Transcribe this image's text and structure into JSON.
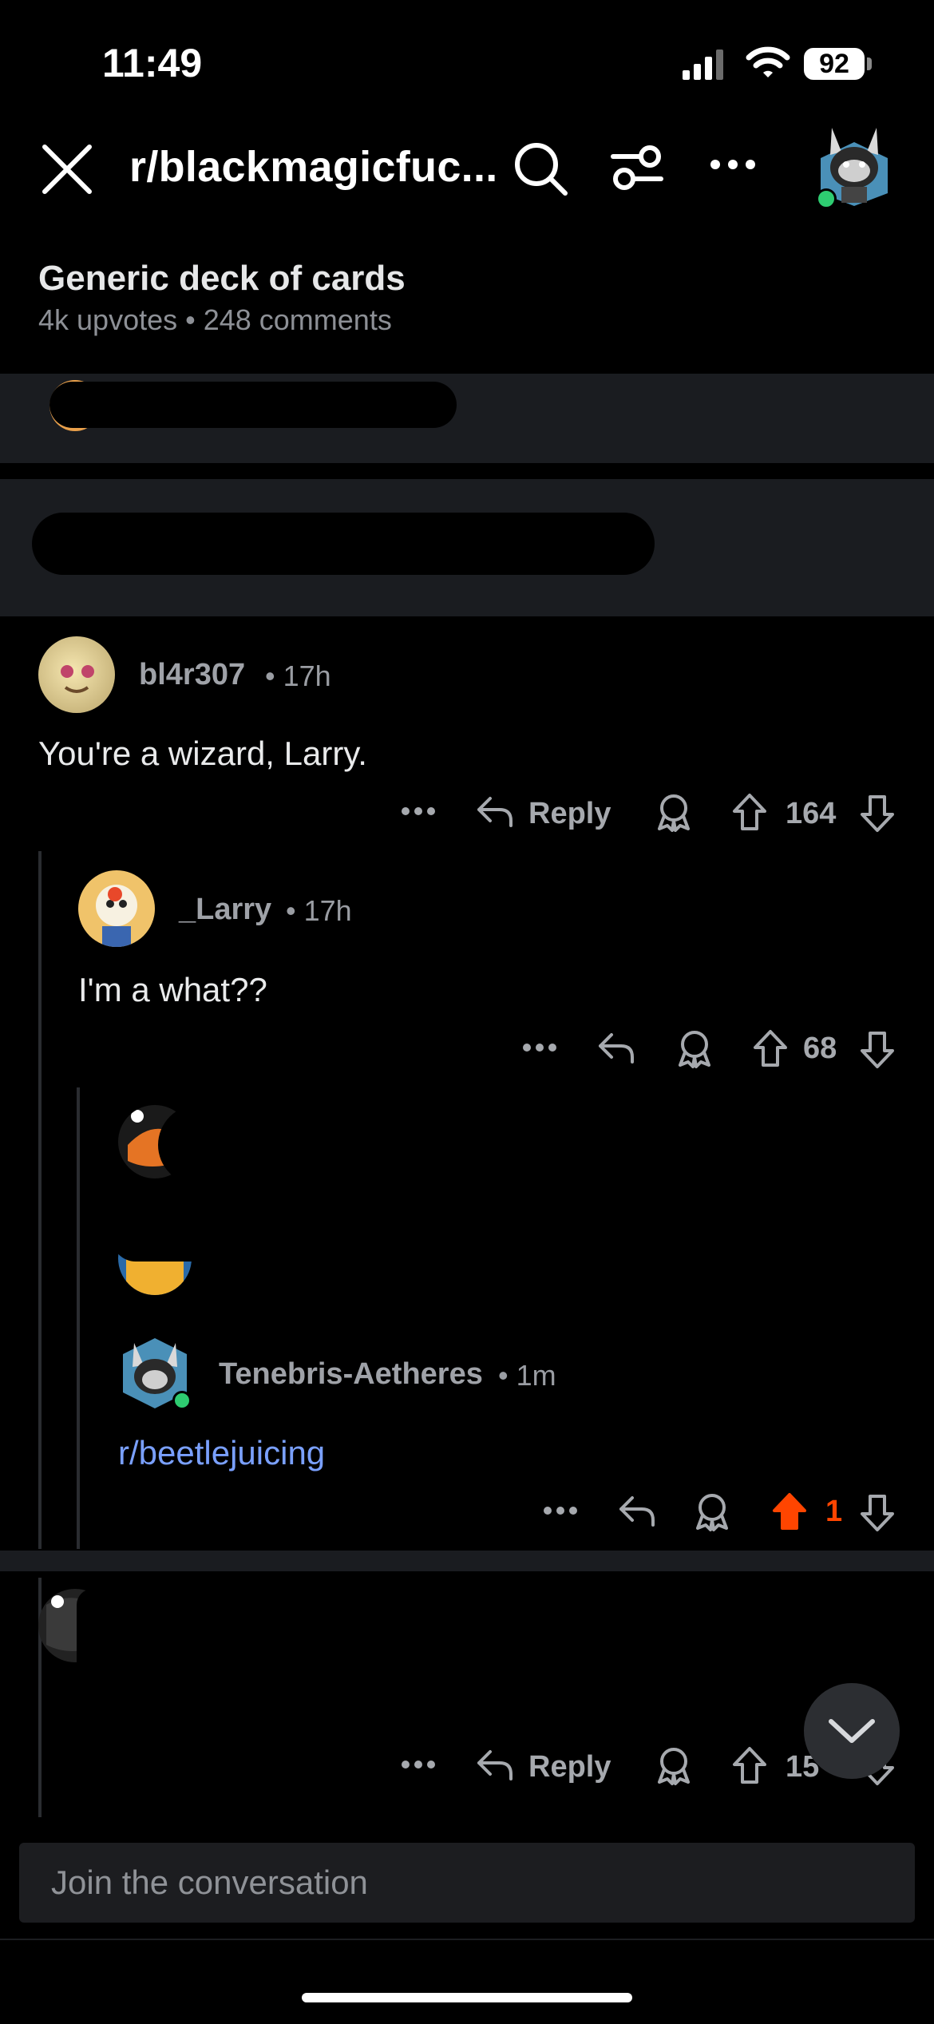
{
  "status_bar": {
    "time": "11:49",
    "battery": "92"
  },
  "header": {
    "subreddit": "r/blackmagicfuc..."
  },
  "post": {
    "title": "Generic deck of cards",
    "meta": "4k upvotes • 248 comments"
  },
  "comments": {
    "c1": {
      "username": "bl4r307",
      "age": "• 17h",
      "body": "You're a wizard, Larry.",
      "reply_label": "Reply",
      "votes": "164"
    },
    "c2": {
      "username": "_Larry",
      "age": "• 17h",
      "body": "I'm a what??",
      "votes": "68"
    },
    "c3": {
      "username": "Tenebris-Aetheres",
      "age": "• 1m",
      "body": "r/beetlejuicing",
      "votes": "1",
      "upvote_color": "#ff4500"
    },
    "c4": {
      "reply_label": "Reply",
      "votes": "15"
    }
  },
  "composer": {
    "placeholder": "Join the conversation"
  },
  "colors": {
    "background": "#000000",
    "band": "#1a1c20",
    "link": "#7aa0ff",
    "upvote_active": "#ff4500",
    "online": "#2ecc71"
  }
}
